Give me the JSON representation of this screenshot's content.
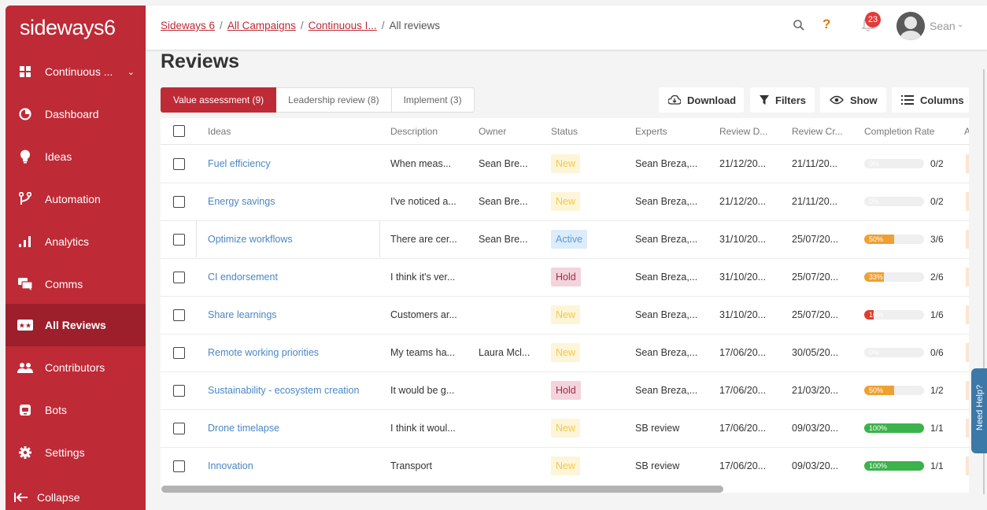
{
  "brand": {
    "logo": "sideways6",
    "accent": "#be2a36"
  },
  "sidebar": {
    "items": [
      {
        "icon": "grid-icon",
        "label": "Continuous ...",
        "chevron": "chevron-down-icon"
      },
      {
        "icon": "pie-chart-icon",
        "label": "Dashboard"
      },
      {
        "icon": "lightbulb-icon",
        "label": "Ideas"
      },
      {
        "icon": "branch-icon",
        "label": "Automation"
      },
      {
        "icon": "bar-chart-icon",
        "label": "Analytics"
      },
      {
        "icon": "chat-icon",
        "label": "Comms"
      },
      {
        "icon": "ticket-icon",
        "label": "All Reviews",
        "active": true
      },
      {
        "icon": "people-icon",
        "label": "Contributors"
      },
      {
        "icon": "bot-icon",
        "label": "Bots"
      },
      {
        "icon": "gear-icon",
        "label": "Settings"
      },
      {
        "icon": "collapse-icon",
        "label": "Collapse"
      }
    ]
  },
  "header": {
    "breadcrumbs": [
      "Sideways 6",
      "All Campaigns",
      "Continuous I...",
      "All reviews"
    ],
    "separator": "/",
    "help_glyph": "?",
    "notifications": "23",
    "user": "Sean"
  },
  "page": {
    "title": "Reviews"
  },
  "tabs": [
    {
      "label": "Value assessment (9)",
      "active": true
    },
    {
      "label": "Leadership review (8)"
    },
    {
      "label": "Implement (3)"
    }
  ],
  "toolbar": {
    "download": "Download",
    "filters": "Filters",
    "show": "Show",
    "columns": "Columns"
  },
  "table": {
    "headers": [
      "Ideas",
      "Description",
      "Owner",
      "Status",
      "Experts",
      "Review D...",
      "Review Cr...",
      "Completion Rate",
      "A"
    ],
    "rows": [
      {
        "idea": "Fuel efficiency",
        "desc": "When meas...",
        "owner": "Sean Bre...",
        "status": "New",
        "experts": "Sean Breza,...",
        "review_d": "21/12/20...",
        "review_cr": "21/11/20...",
        "pct": 0,
        "pct_label": "0%",
        "frac": "0/2"
      },
      {
        "idea": "Energy savings",
        "desc": "I've noticed a...",
        "owner": "Sean Bre...",
        "status": "New",
        "experts": "Sean Breza,...",
        "review_d": "21/12/20...",
        "review_cr": "21/11/20...",
        "pct": 0,
        "pct_label": "0%",
        "frac": "0/2"
      },
      {
        "idea": "Optimize workflows",
        "desc": "There are cer...",
        "owner": "Sean Bre...",
        "status": "Active",
        "experts": "Sean Breza,...",
        "review_d": "31/10/20...",
        "review_cr": "25/07/20...",
        "pct": 50,
        "pct_label": "50%",
        "frac": "3/6"
      },
      {
        "idea": "CI endorsement",
        "desc": "I think it's ver...",
        "owner": "",
        "status": "Hold",
        "experts": "Sean Breza,...",
        "review_d": "31/10/20...",
        "review_cr": "25/07/20...",
        "pct": 33,
        "pct_label": "33%",
        "frac": "2/6"
      },
      {
        "idea": "Share learnings",
        "desc": "Customers ar...",
        "owner": "",
        "status": "New",
        "experts": "Sean Breza,...",
        "review_d": "31/10/20...",
        "review_cr": "25/07/20...",
        "pct": 16,
        "pct_label": "16%",
        "frac": "1/6"
      },
      {
        "idea": "Remote working priorities",
        "desc": "My teams ha...",
        "owner": "Laura Mcl...",
        "status": "New",
        "experts": "Sean Breza,...",
        "review_d": "17/06/20...",
        "review_cr": "30/05/20...",
        "pct": 0,
        "pct_label": "0%",
        "frac": "0/6"
      },
      {
        "idea": "Sustainability - ecosystem creation",
        "desc": "It would be g...",
        "owner": "",
        "status": "Hold",
        "experts": "Sean Breza,...",
        "review_d": "17/06/20...",
        "review_cr": "21/03/20...",
        "pct": 50,
        "pct_label": "50%",
        "frac": "1/2"
      },
      {
        "idea": "Drone timelapse",
        "desc": "I think it woul...",
        "owner": "",
        "status": "New",
        "experts": "SB review",
        "review_d": "17/06/20...",
        "review_cr": "09/03/20...",
        "pct": 100,
        "pct_label": "100%",
        "frac": "1/1"
      },
      {
        "idea": "Innovation",
        "desc": "Transport",
        "owner": "",
        "status": "New",
        "experts": "SB review",
        "review_d": "17/06/20...",
        "review_cr": "09/03/20...",
        "pct": 100,
        "pct_label": "100%",
        "frac": "1/1"
      }
    ]
  },
  "help_widget": {
    "label": "Need Help?"
  },
  "colors": {
    "new_bg": "#fdf5d8",
    "active_bg": "#dcecfb",
    "hold_bg": "#f3d3dc",
    "bar_orange": "#f0a030",
    "bar_red": "#e23b2b",
    "bar_green": "#3bb24a"
  }
}
